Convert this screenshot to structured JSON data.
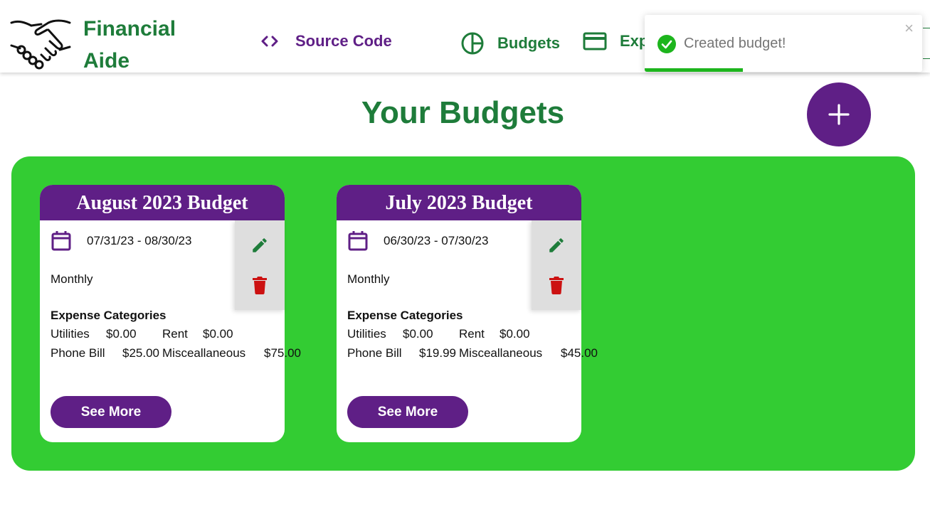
{
  "header": {
    "brand_line1": "Financial",
    "brand_line2": "Aide",
    "nav": {
      "source_code": "Source Code",
      "budgets": "Budgets",
      "expenses": "Exp"
    }
  },
  "toast": {
    "message": "Created budget!",
    "close": "×",
    "progress_fraction": 0.355
  },
  "page": {
    "title": "Your Budgets",
    "add_button_icon": "plus-icon"
  },
  "budgets": [
    {
      "title": "August 2023 Budget",
      "date_range": "07/31/23 - 08/30/23",
      "frequency": "Monthly",
      "categories_label": "Expense Categories",
      "categories": [
        {
          "name": "Utilities",
          "amount": "$0.00"
        },
        {
          "name": "Rent",
          "amount": "$0.00"
        },
        {
          "name": "Phone Bill",
          "amount": "$25.00"
        },
        {
          "name": "Misceallaneous",
          "amount": "$75.00"
        }
      ],
      "see_more": "See More"
    },
    {
      "title": "July 2023 Budget",
      "date_range": "06/30/23 - 07/30/23",
      "frequency": "Monthly",
      "categories_label": "Expense Categories",
      "categories": [
        {
          "name": "Utilities",
          "amount": "$0.00"
        },
        {
          "name": "Rent",
          "amount": "$0.00"
        },
        {
          "name": "Phone Bill",
          "amount": "$19.99"
        },
        {
          "name": "Misceallaneous",
          "amount": "$45.00"
        }
      ],
      "see_more": "See More"
    }
  ],
  "colors": {
    "brand_green": "#1e7c3a",
    "brand_purple": "#5f1f86",
    "panel_green": "#33cc33",
    "delete_red": "#cc1111",
    "toast_success": "#1db51d"
  }
}
